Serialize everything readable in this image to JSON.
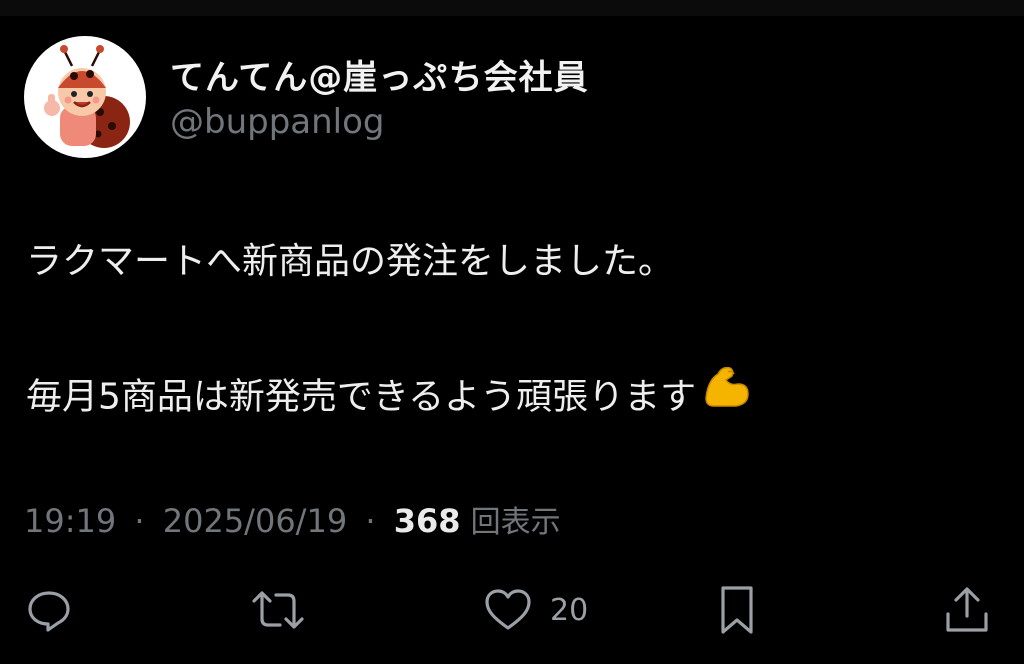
{
  "author": {
    "display_name": "てんてん@崖っぷち会社員",
    "handle": "@buppanlog",
    "avatar_icon": "ladybug-mascot-avatar"
  },
  "tweet": {
    "line1": "ラクマートへ新商品の発注をしました。",
    "line2": "毎月5商品は新発売できるよう頑張ります",
    "line2_emoji": "flexed-biceps-emoji"
  },
  "meta": {
    "time": "19:19",
    "date": "2025/06/19",
    "views_count": "368",
    "views_label": "回表示",
    "separator": "·"
  },
  "actions": {
    "reply_icon": "reply-icon",
    "retweet_icon": "retweet-icon",
    "like_icon": "heart-icon",
    "like_count": "20",
    "bookmark_icon": "bookmark-icon",
    "share_icon": "share-icon"
  },
  "colors": {
    "background": "#000000",
    "text": "#e7e9ea",
    "secondary": "#71767b"
  }
}
